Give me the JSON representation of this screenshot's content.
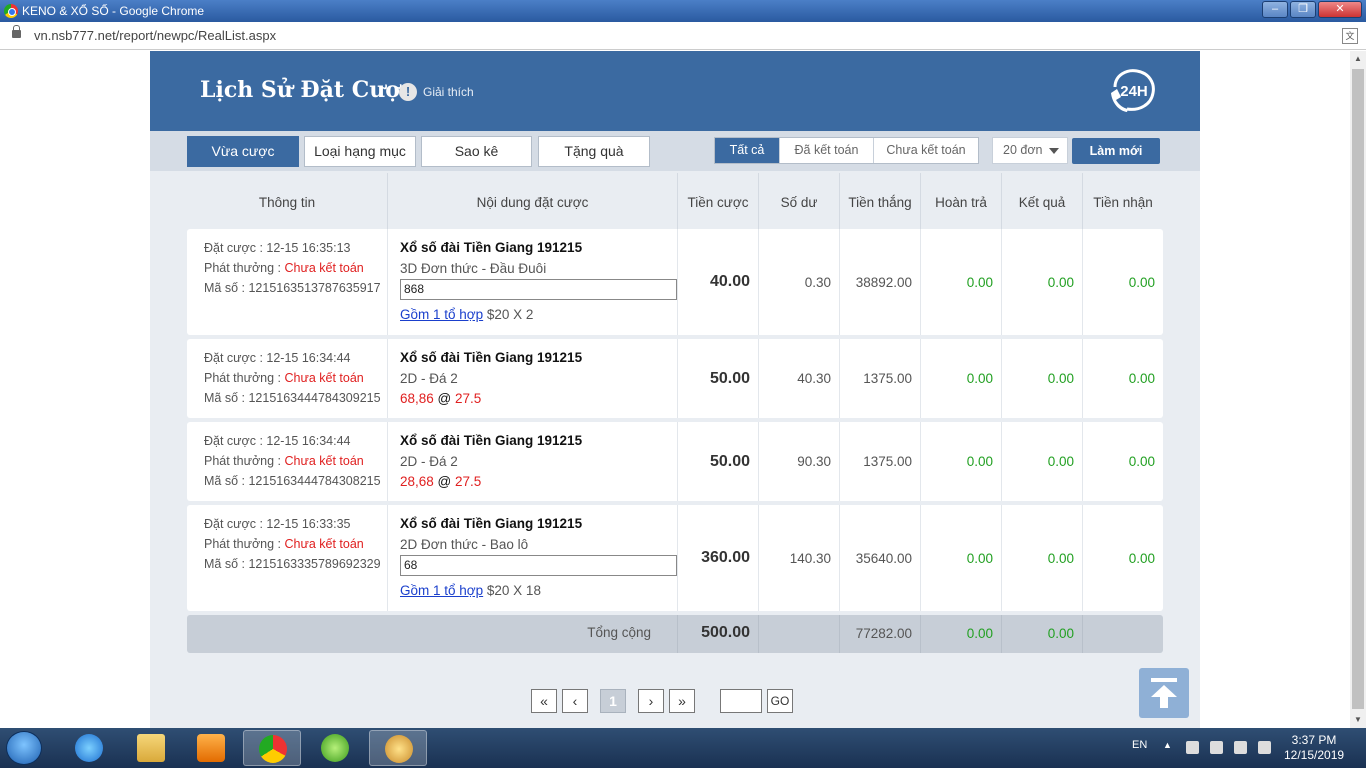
{
  "window": {
    "title": "KENO & XỔ SỐ - Google Chrome",
    "url": "vn.nsb777.net/report/newpc/RealList.aspx"
  },
  "header": {
    "title": "Lịch Sử Đặt Cược",
    "explain": "Giải thích",
    "badge": "24H"
  },
  "tabs": [
    "Vừa cược",
    "Loại hạng mục",
    "Sao kê",
    "Tặng quà"
  ],
  "filters": [
    "Tất cả",
    "Đã kết toán",
    "Chưa kết toán"
  ],
  "page_size": "20 đơn",
  "refresh_label": "Làm mới",
  "columns": [
    "Thông tin",
    "Nội dung đặt cược",
    "Tiền cược",
    "Số dư",
    "Tiền thắng",
    "Hoàn trả",
    "Kết quả",
    "Tiền nhận"
  ],
  "rows": [
    {
      "placed": "Đặt cược : 12-15 16:35:13",
      "payout_label": "Phát thưởng : ",
      "payout_status": "Chưa kết toán",
      "code": "Mã số : 1215163513787635917",
      "lottery": "Xổ số đài Tiền Giang 191215",
      "bet_type": "3D Đơn thức - Đầu Đuôi",
      "numbers": "868",
      "combo_link": "Gồm 1 tổ hợp",
      "combo_rest": " $20 X 2",
      "stake": "40.00",
      "balance": "0.30",
      "win": "38892.00",
      "refund": "0.00",
      "result": "0.00",
      "received": "0.00"
    },
    {
      "placed": "Đặt cược : 12-15 16:34:44",
      "payout_label": "Phát thưởng : ",
      "payout_status": "Chưa kết toán",
      "code": "Mã số : 1215163444784309215",
      "lottery": "Xổ số đài Tiền Giang 191215",
      "bet_type": "2D - Đá 2",
      "pair": "68,86",
      "at": " @ ",
      "odds": "27.5",
      "stake": "50.00",
      "balance": "40.30",
      "win": "1375.00",
      "refund": "0.00",
      "result": "0.00",
      "received": "0.00"
    },
    {
      "placed": "Đặt cược : 12-15 16:34:44",
      "payout_label": "Phát thưởng : ",
      "payout_status": "Chưa kết toán",
      "code": "Mã số : 1215163444784308215",
      "lottery": "Xổ số đài Tiền Giang 191215",
      "bet_type": "2D - Đá 2",
      "pair": "28,68",
      "at": " @ ",
      "odds": "27.5",
      "stake": "50.00",
      "balance": "90.30",
      "win": "1375.00",
      "refund": "0.00",
      "result": "0.00",
      "received": "0.00"
    },
    {
      "placed": "Đặt cược : 12-15 16:33:35",
      "payout_label": "Phát thưởng : ",
      "payout_status": "Chưa kết toán",
      "code": "Mã số : 1215163335789692329",
      "lottery": "Xổ số đài Tiền Giang 191215",
      "bet_type": "2D Đơn thức - Bao lô",
      "numbers": "68",
      "combo_link": "Gồm 1 tổ hợp",
      "combo_rest": " $20 X 18",
      "stake": "360.00",
      "balance": "140.30",
      "win": "35640.00",
      "refund": "0.00",
      "result": "0.00",
      "received": "0.00"
    }
  ],
  "total": {
    "label": "Tổng cộng",
    "stake": "500.00",
    "win": "77282.00",
    "refund": "0.00",
    "result": "0.00"
  },
  "pager": {
    "first": "«",
    "prev": "‹",
    "current": "1",
    "next": "›",
    "last": "»",
    "go": "GO"
  },
  "taskbar": {
    "lang": "EN",
    "time": "3:37 PM",
    "date": "12/15/2019"
  },
  "colors": {
    "header_blue": "#3b6aa1",
    "status_red": "#e02020",
    "value_green": "#22a022"
  }
}
